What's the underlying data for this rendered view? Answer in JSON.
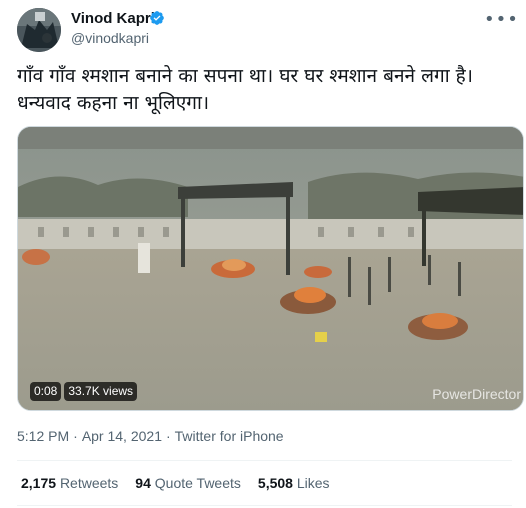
{
  "author": {
    "name": "Vinod Kapri",
    "handle": "@vinodkapri",
    "verified": true
  },
  "tweet": {
    "text": "गाँव गाँव श्मशान बनाने का सपना था। घर घर श्मशान बनने लगा है। धन्यवाद कहना ना भूलिएगा।"
  },
  "media": {
    "duration": "0:08",
    "views": "33.7K views",
    "watermark": "PowerDirector"
  },
  "meta": {
    "time": "5:12 PM",
    "separator1": "·",
    "date": "Apr 14, 2021",
    "separator2": "·",
    "source": "Twitter for iPhone"
  },
  "stats": {
    "retweets_count": "2,175",
    "retweets_label": "Retweets",
    "quotes_count": "94",
    "quotes_label": "Quote Tweets",
    "likes_count": "5,508",
    "likes_label": "Likes"
  },
  "icons": {
    "verified": "verified-badge-icon",
    "more": "more-options-icon"
  },
  "colors": {
    "verified_blue": "#1d9bf0",
    "secondary_text": "#536471",
    "primary_text": "#0f1419"
  }
}
